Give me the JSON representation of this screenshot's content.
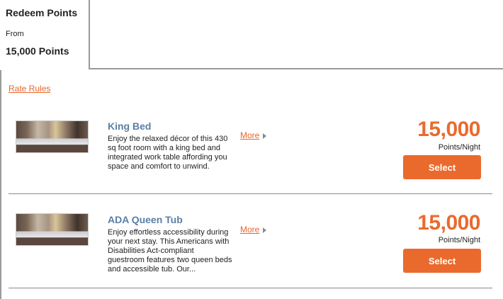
{
  "tab": {
    "title": "Redeem Points",
    "from_label": "From",
    "points": "15,000 Points"
  },
  "rate_rules": "Rate Rules",
  "rooms": [
    {
      "name": "King Bed",
      "description": "Enjoy the relaxed décor of this 430 sq foot room with a king bed and integrated work table affording you space and comfort to unwind.",
      "more": "More",
      "price": "15,000",
      "unit": "Points/Night",
      "select": "Select"
    },
    {
      "name": "ADA Queen Tub",
      "description": "Enjoy effortless accessibility during your next stay. This Americans with Disabilities Act-compliant guestroom features two queen beds and accessible tub. Our...",
      "more": "More",
      "price": "15,000",
      "unit": "Points/Night",
      "select": "Select"
    }
  ],
  "colors": {
    "accent": "#ea6a2e",
    "room_name": "#5b7ea5",
    "border": "#9a9a9a"
  }
}
